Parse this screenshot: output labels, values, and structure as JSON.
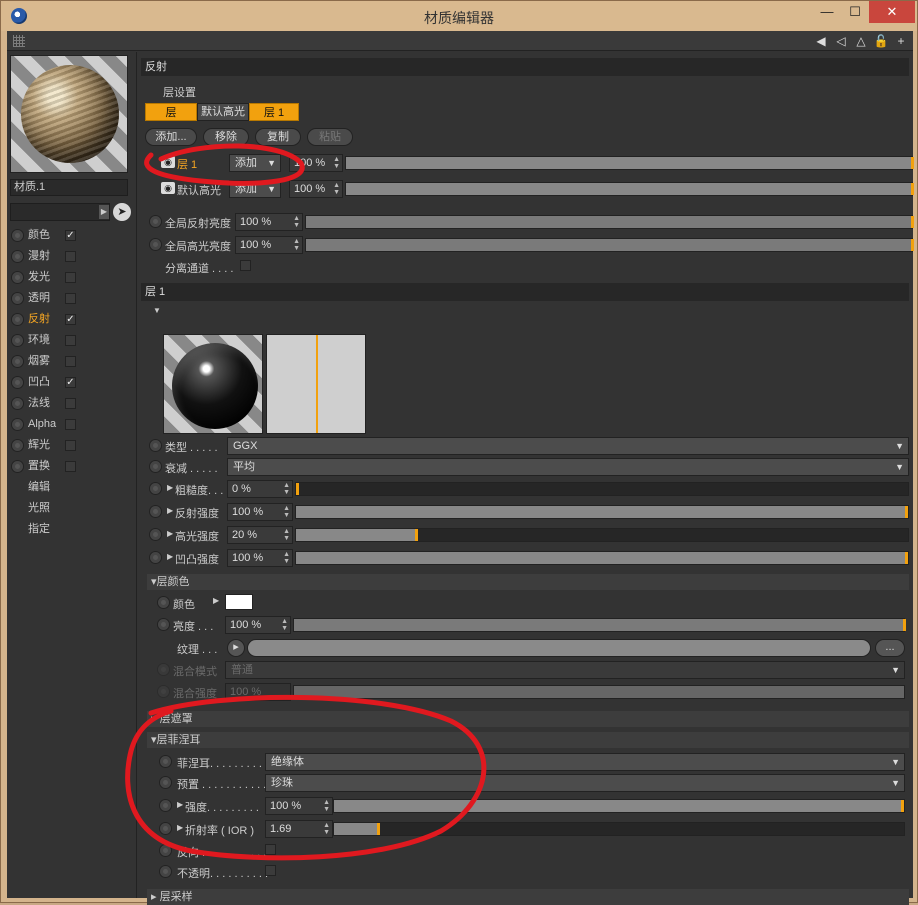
{
  "window": {
    "title": "材质编辑器",
    "min": "—",
    "max": "☐",
    "close": "✕"
  },
  "toolbar": {
    "nav_icons": [
      "◀",
      "◁",
      "△",
      "🔓",
      "+"
    ]
  },
  "material": {
    "name": "材质.1"
  },
  "channels": [
    {
      "label": "颜色",
      "checked": true,
      "active": false
    },
    {
      "label": "漫射",
      "checked": false,
      "active": false
    },
    {
      "label": "发光",
      "checked": false,
      "active": false
    },
    {
      "label": "透明",
      "checked": false,
      "active": false
    },
    {
      "label": "反射",
      "checked": true,
      "active": true
    },
    {
      "label": "环境",
      "checked": false,
      "active": false
    },
    {
      "label": "烟雾",
      "checked": false,
      "active": false
    },
    {
      "label": "凹凸",
      "checked": true,
      "active": false
    },
    {
      "label": "法线",
      "checked": false,
      "active": false
    },
    {
      "label": "Alpha",
      "checked": false,
      "active": false
    },
    {
      "label": "辉光",
      "checked": false,
      "active": false
    },
    {
      "label": "置换",
      "checked": false,
      "active": false
    }
  ],
  "channel_extras": [
    "编辑",
    "光照",
    "指定"
  ],
  "reflect": {
    "section": "反射",
    "layer_settings": "层设置",
    "tabs": [
      "层",
      "默认高光",
      "层 1"
    ],
    "actions": [
      "添加...",
      "移除",
      "复制",
      "粘贴"
    ],
    "layers": [
      {
        "name": "层 1",
        "mode": "添加",
        "value": "100 %"
      },
      {
        "name": "默认高光",
        "mode": "添加",
        "value": "100 %"
      }
    ],
    "global_reflect_label": "全局反射亮度",
    "global_reflect_value": "100 %",
    "global_spec_label": "全局高光亮度",
    "global_spec_value": "100 %",
    "separate_label": "分离通道 . . . ."
  },
  "layer1": {
    "section": "层 1",
    "type_label": "类型 . . . . .",
    "type_value": "GGX",
    "atten_label": "衰减 . . . . .",
    "atten_value": "平均",
    "rough_label": "粗糙度. . . .",
    "rough_value": "0 %",
    "rough_level": 0,
    "refl_label": "反射强度",
    "refl_value": "100 %",
    "refl_level": 1,
    "spec_label": "高光强度",
    "spec_value": "20 %",
    "spec_level": 0.2,
    "bump_label": "凹凸强度",
    "bump_value": "100 %",
    "bump_level": 1
  },
  "layer_color": {
    "head": "层颜色",
    "color_label": "颜色",
    "bright_label": "亮度 . . .",
    "bright_value": "100 %",
    "texture_label": "纹理 . . .",
    "texture_btn": "...",
    "blend_mode_label": "混合模式",
    "blend_mode_value": "普通",
    "blend_str_label": "混合强度",
    "blend_str_value": "100 %"
  },
  "layer_mask": {
    "head": "层遮罩"
  },
  "fresnel": {
    "head": "层菲涅耳",
    "fresnel_label": "菲涅耳. . . . . . . . .",
    "fresnel_value": "绝缘体",
    "preset_label": "预置 . . . . . . . . . . .",
    "preset_value": "珍珠",
    "strength_label": "强度. . . . . . . . .",
    "strength_value": "100 %",
    "strength_level": 1,
    "ior_label": "折射率 ( IOR )",
    "ior_value": "1.69",
    "ior_level": 0.08,
    "invert_label": "反向 . . . . . . . . . . .",
    "opaque_label": "不透明. . . . . . . . . ."
  },
  "layer_sampling": {
    "head": "层采样"
  },
  "colors": {
    "accent": "#f2a10e",
    "annotation": "#e0191f",
    "panel": "#333333",
    "header": "#272727"
  }
}
